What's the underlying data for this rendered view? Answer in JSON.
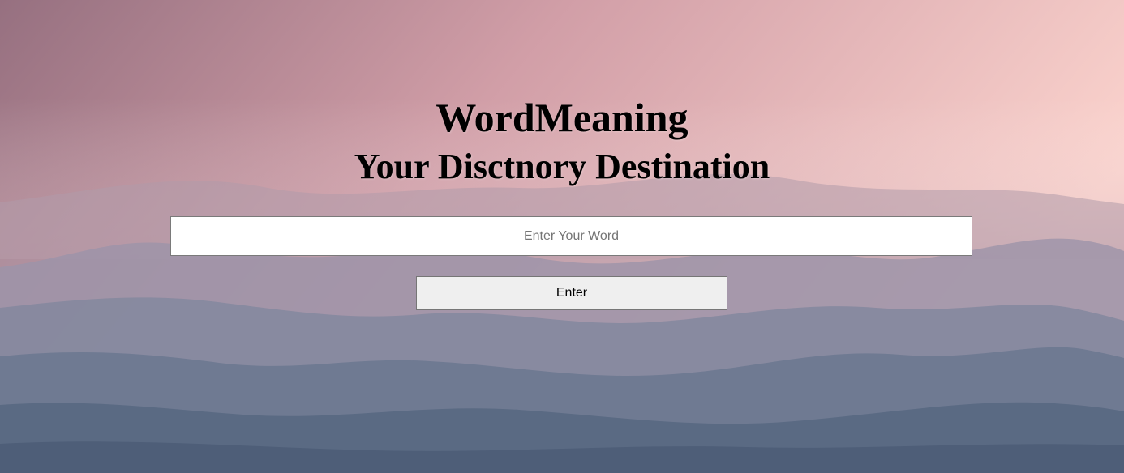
{
  "header": {
    "title": "WordMeaning",
    "subtitle": "Your Disctnory Destination"
  },
  "search": {
    "placeholder": "Enter Your Word",
    "value": ""
  },
  "actions": {
    "enter_label": "Enter"
  },
  "colors": {
    "sky_top_left": "#9a7785",
    "sky_top_right": "#f8d2cd",
    "mountain_far": "#a99aa8",
    "mountain_mid": "#8a8ea4",
    "mountain_near": "#5f7088",
    "button_bg": "#efefef",
    "input_bg": "#ffffff",
    "text": "#000000"
  }
}
